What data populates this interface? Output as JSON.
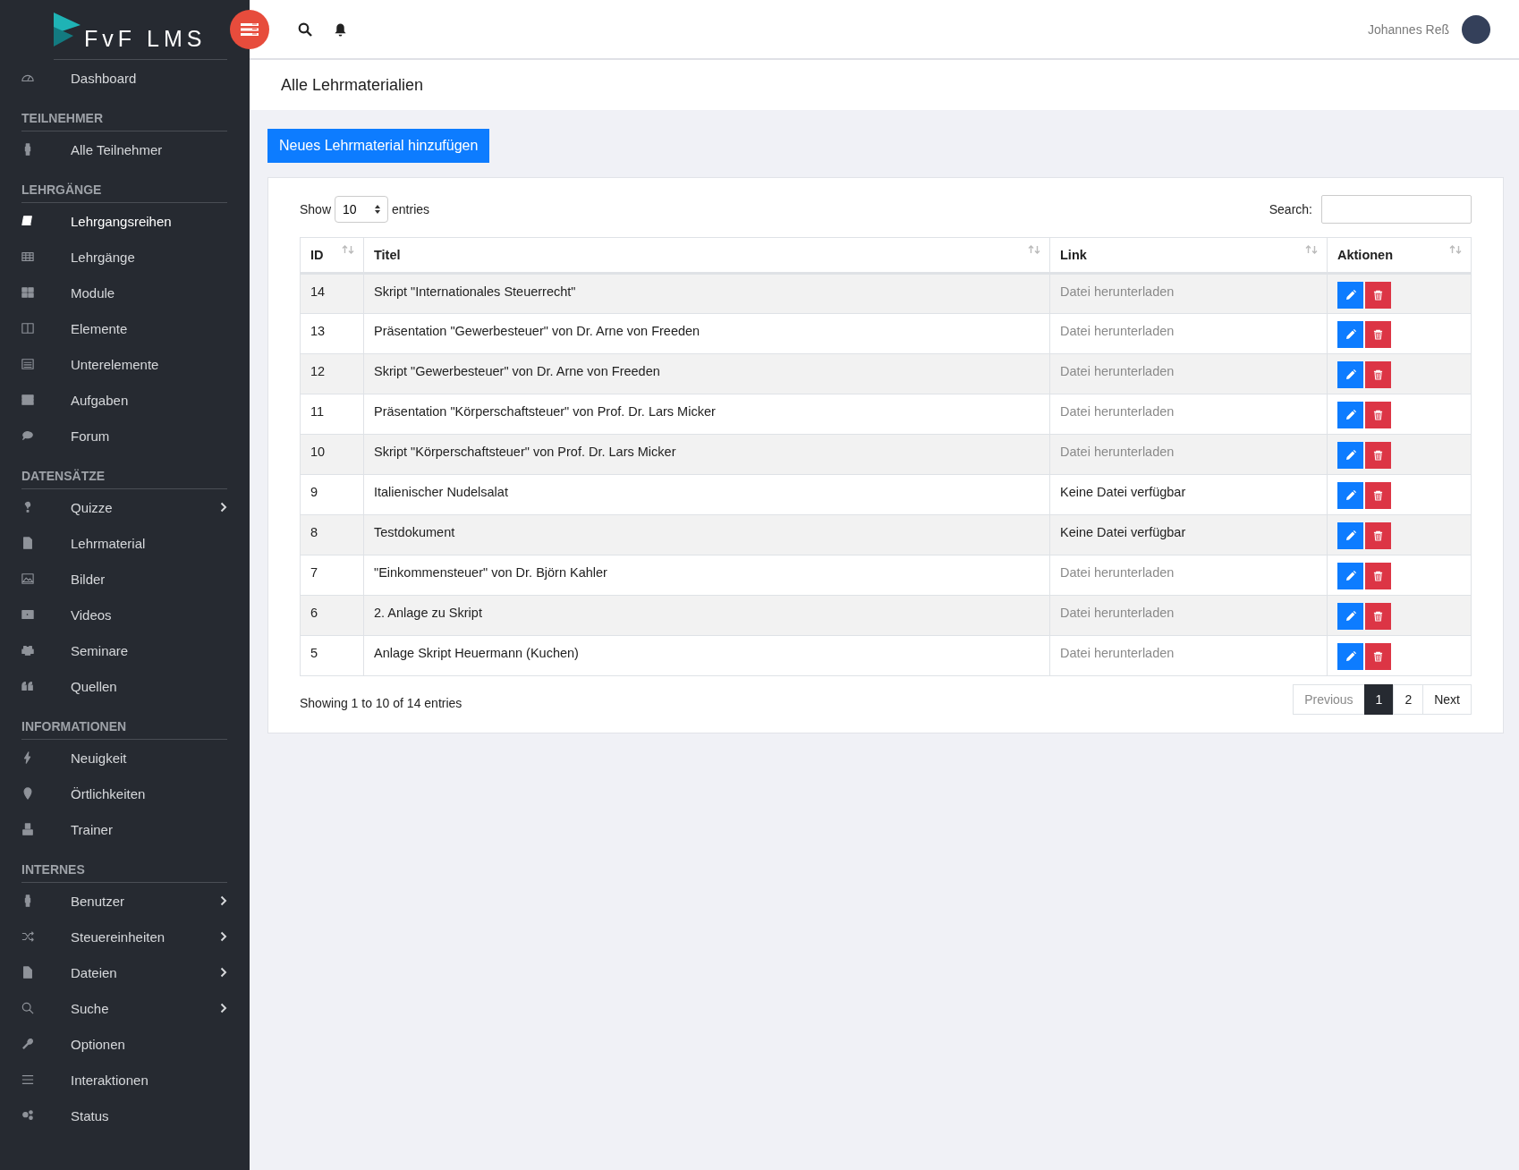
{
  "logo": {
    "text": "FvF LMS"
  },
  "sidebar": {
    "sections": [
      {
        "items": [
          {
            "label": "Dashboard",
            "selected": false,
            "has_submenu": false
          }
        ]
      },
      {
        "title": "TEILNEHMER",
        "items": [
          {
            "label": "Alle Teilnehmer",
            "selected": false,
            "has_submenu": false
          }
        ]
      },
      {
        "title": "LEHRGÄNGE",
        "items": [
          {
            "label": "Lehrgangsreihen",
            "selected": true,
            "has_submenu": false
          },
          {
            "label": "Lehrgänge",
            "selected": false,
            "has_submenu": false
          },
          {
            "label": "Module",
            "selected": false,
            "has_submenu": false
          },
          {
            "label": "Elemente",
            "selected": false,
            "has_submenu": false
          },
          {
            "label": "Unterelemente",
            "selected": false,
            "has_submenu": false
          },
          {
            "label": "Aufgaben",
            "selected": false,
            "has_submenu": false
          },
          {
            "label": "Forum",
            "selected": false,
            "has_submenu": false
          }
        ]
      },
      {
        "title": "DATENSÄTZE",
        "items": [
          {
            "label": "Quizze",
            "selected": false,
            "has_submenu": true
          },
          {
            "label": "Lehrmaterial",
            "selected": false,
            "has_submenu": false
          },
          {
            "label": "Bilder",
            "selected": false,
            "has_submenu": false
          },
          {
            "label": "Videos",
            "selected": false,
            "has_submenu": false
          },
          {
            "label": "Seminare",
            "selected": false,
            "has_submenu": false
          },
          {
            "label": "Quellen",
            "selected": false,
            "has_submenu": false
          }
        ]
      },
      {
        "title": "INFORMATIONEN",
        "items": [
          {
            "label": "Neuigkeit",
            "selected": false,
            "has_submenu": false
          },
          {
            "label": "Örtlichkeiten",
            "selected": false,
            "has_submenu": false
          },
          {
            "label": "Trainer",
            "selected": false,
            "has_submenu": false
          }
        ]
      },
      {
        "title": "INTERNES",
        "items": [
          {
            "label": "Benutzer",
            "selected": false,
            "has_submenu": true
          },
          {
            "label": "Steuereinheiten",
            "selected": false,
            "has_submenu": true
          },
          {
            "label": "Dateien",
            "selected": false,
            "has_submenu": true
          },
          {
            "label": "Suche",
            "selected": false,
            "has_submenu": true
          },
          {
            "label": "Optionen",
            "selected": false,
            "has_submenu": false
          },
          {
            "label": "Interaktionen",
            "selected": false,
            "has_submenu": false
          },
          {
            "label": "Status",
            "selected": false,
            "has_submenu": false
          }
        ]
      }
    ]
  },
  "topbar": {
    "user_name": "Johannes Reß"
  },
  "page_title": "Alle Lehrmaterialien",
  "add_button": "Neues Lehrmaterial hinzufügen",
  "table_controls": {
    "show_label": "Show",
    "page_size": "10",
    "entries_label": "entries",
    "search_label": "Search:"
  },
  "table": {
    "columns": [
      "ID",
      "Titel",
      "Link",
      "Aktionen"
    ],
    "rows": [
      {
        "id": "14",
        "title": "Skript \"Internationales Steuerrecht\"",
        "link": "Datei herunterladen",
        "file_available": true
      },
      {
        "id": "13",
        "title": "Präsentation \"Gewerbesteuer\" von Dr. Arne von Freeden",
        "link": "Datei herunterladen",
        "file_available": true
      },
      {
        "id": "12",
        "title": "Skript \"Gewerbesteuer\" von Dr. Arne von Freeden",
        "link": "Datei herunterladen",
        "file_available": true
      },
      {
        "id": "11",
        "title": "Präsentation \"Körperschaftsteuer\" von Prof. Dr. Lars Micker",
        "link": "Datei herunterladen",
        "file_available": true
      },
      {
        "id": "10",
        "title": "Skript \"Körperschaftsteuer\" von Prof. Dr. Lars Micker",
        "link": "Datei herunterladen",
        "file_available": true
      },
      {
        "id": "9",
        "title": "Italienischer Nudelsalat",
        "link": "Keine Datei verfügbar",
        "file_available": false
      },
      {
        "id": "8",
        "title": "Testdokument",
        "link": "Keine Datei verfügbar",
        "file_available": false
      },
      {
        "id": "7",
        "title": "\"Einkommensteuer\" von Dr. Björn Kahler",
        "link": "Datei herunterladen",
        "file_available": true
      },
      {
        "id": "6",
        "title": "2. Anlage zu Skript",
        "link": "Datei herunterladen",
        "file_available": true
      },
      {
        "id": "5",
        "title": "Anlage Skript Heuermann (Kuchen)",
        "link": "Datei herunterladen",
        "file_available": true
      }
    ]
  },
  "info": "Showing 1 to 10 of 14 entries",
  "pagination": [
    {
      "label": "Previous",
      "selected": false,
      "disabled": true
    },
    {
      "label": "1",
      "selected": true,
      "disabled": false
    },
    {
      "label": "2",
      "selected": false,
      "disabled": false
    },
    {
      "label": "Next",
      "selected": false,
      "disabled": false
    }
  ]
}
